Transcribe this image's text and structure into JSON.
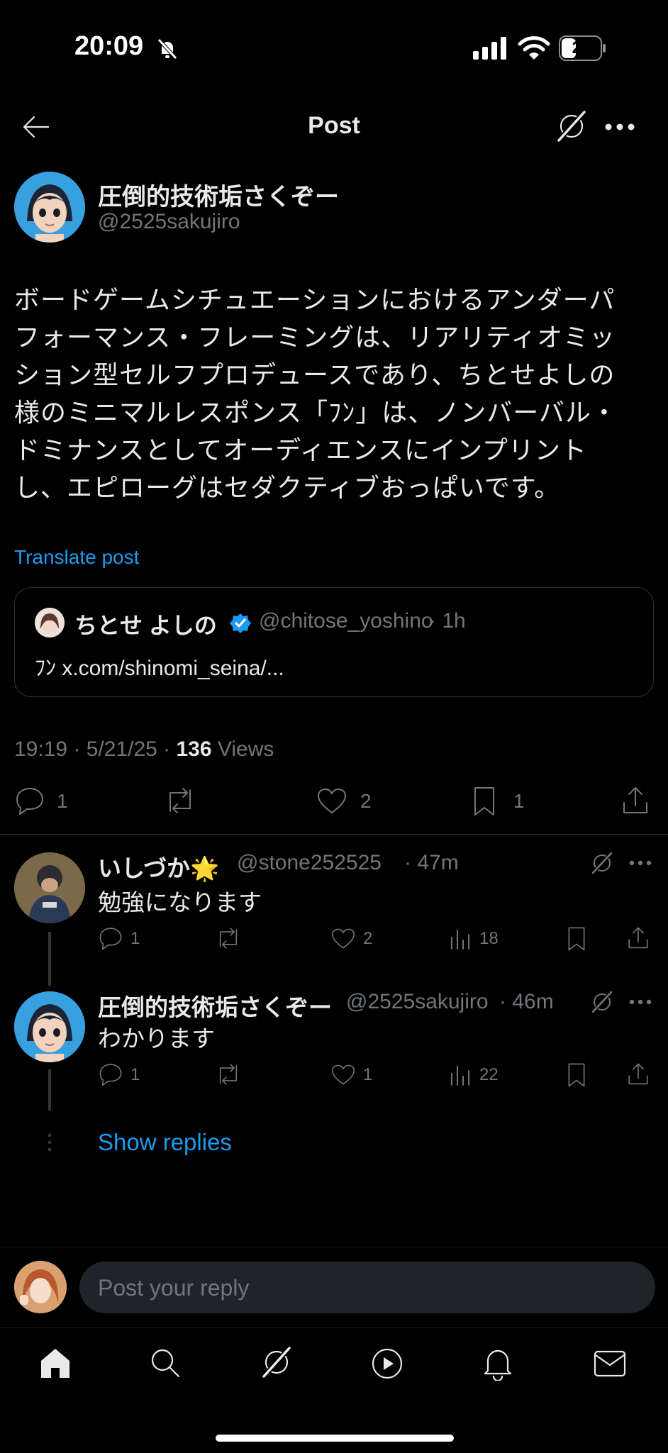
{
  "status": {
    "time": "20:09",
    "battery": "27"
  },
  "header": {
    "title": "Post"
  },
  "post": {
    "author_name": "圧倒的技術垢さくぞー",
    "author_handle": "@2525sakujiro",
    "text_lines": [
      "ボードゲームシチュエーションにおけるアンダーパ",
      "フォーマンス・フレーミングは、リアリティオミッ",
      "ション型セルフプロデュースであり、ちとせよしの",
      "様のミニマルレスポンス「ﾌﾝ」は、ノンバーバル・",
      "ドミナンスとしてオーディエンスにインプリント",
      "し、エピローグはセダクティブおっぱいです。"
    ],
    "translate_label": "Translate post",
    "time_date": "19:19 · 5/21/25 · ",
    "views_count": "136",
    "views_label": " Views",
    "replies": "1",
    "likes": "2",
    "bookmarks": "1"
  },
  "quote": {
    "name": "ちとせ よしの",
    "handle": "@chitose_yoshino",
    "age": "· 1h",
    "text": "ﾌﾝ x.com/shinomi_seina/..."
  },
  "replies": [
    {
      "name": "いしづか🌟",
      "handle": "@stone252525",
      "age": "· 47m",
      "text": "勉強になります",
      "replies": "1",
      "likes": "2",
      "views": "18"
    },
    {
      "name": "圧倒的技術垢さくぞー",
      "handle": "@2525sakujiro",
      "age": "· 46m",
      "text": "わかります",
      "replies": "1",
      "likes": "1",
      "views": "22"
    }
  ],
  "show_replies_label": "Show replies",
  "composer": {
    "placeholder": "Post your reply"
  },
  "nav": [
    "home-icon",
    "search-icon",
    "grok-icon",
    "play-icon",
    "bell-icon",
    "mail-icon"
  ]
}
